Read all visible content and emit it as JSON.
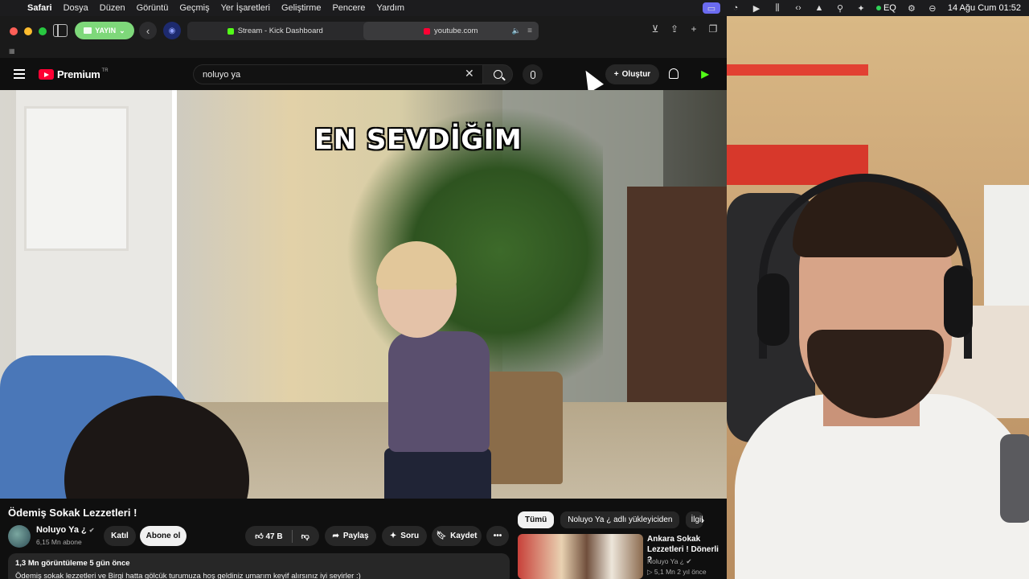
{
  "menubar": {
    "app": "Safari",
    "items": [
      "Dosya",
      "Düzen",
      "Görüntü",
      "Geçmiş",
      "Yer İşaretleri",
      "Geliştirme",
      "Pencere",
      "Yardım"
    ],
    "eq_label": "EQ",
    "datetime": "14 Ağu Cum  01:52"
  },
  "safari": {
    "profile_label": "YAYIN",
    "tabs": [
      {
        "title": "Stream - Kick Dashboard",
        "favicon": "kick-icon"
      },
      {
        "title": "youtube.com",
        "favicon": "youtube-icon",
        "playing_audio": true
      }
    ]
  },
  "youtube": {
    "logo_text": "Premium",
    "logo_region": "TR",
    "search_value": "noluyo ya",
    "create_label": "Oluştur"
  },
  "video": {
    "caption": "EN SEVDİĞİM"
  },
  "info": {
    "title": "Ödemiş Sokak Lezzetleri !",
    "channel_name": "Noluyo Ya ¿",
    "subscribers": "6,15 Mn abone",
    "join_label": "Katıl",
    "subscribe_label": "Abone ol",
    "like_count": "47 B",
    "share_label": "Paylaş",
    "ask_label": "Soru",
    "save_label": "Kaydet",
    "desc_meta": "1,3 Mn görüntüleme  5 gün önce",
    "desc_text": "Ödemiş sokak lezzetleri ve Birgi hatta gölcük turumuza hoş geldiniz umarım keyif alırsınız iyi seyirler :)"
  },
  "sidebar": {
    "chips": [
      "Tümü",
      "Noluyo Ya ¿ adlı yükleyiciden",
      "İlgili"
    ],
    "recommendation": {
      "title": "Ankara Sokak Lezzetleri ! Dönerli ?",
      "channel": "Noluyo Ya ¿",
      "meta": "5,1 Mn   2 yıl önce"
    }
  }
}
